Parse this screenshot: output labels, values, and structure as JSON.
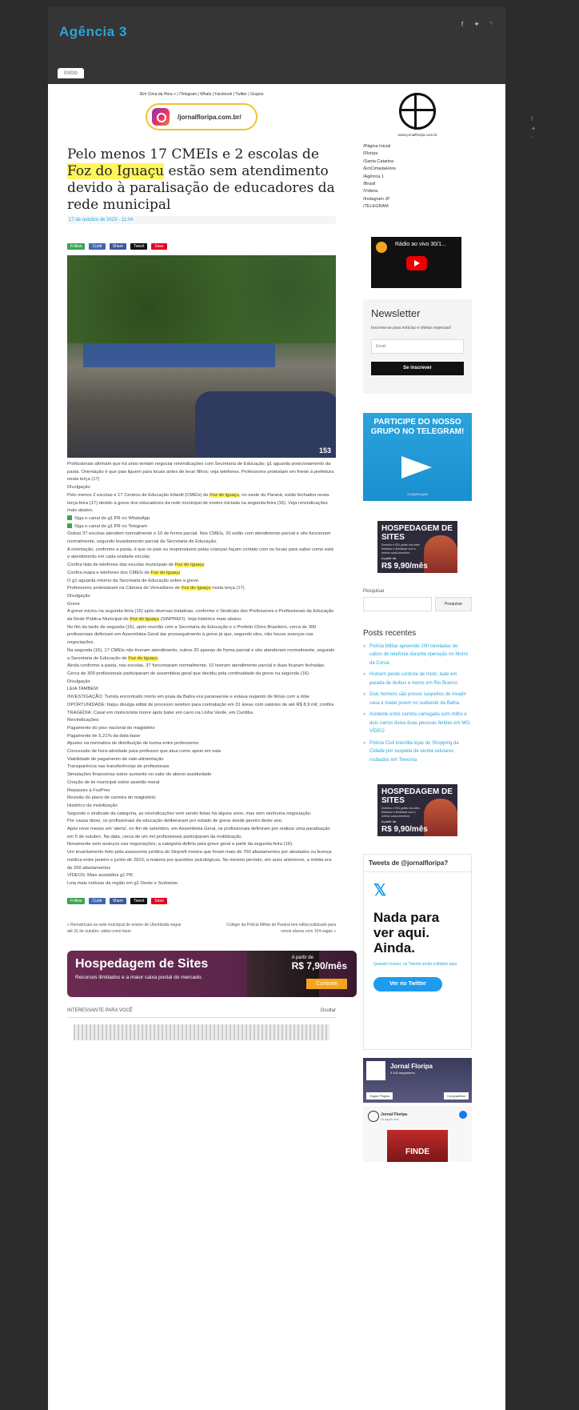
{
  "site": {
    "logo": "Agência 3",
    "tab": "Início"
  },
  "top_social": [
    "f",
    "t",
    "rss"
  ],
  "side_social": [
    "f",
    "t",
    "rss"
  ],
  "article": {
    "toplinks": "/Em Cima da Hora > | /Telegram | Whats | Facebook | Twitter | Grupos",
    "instagram": "/jornalfloripa.com.br/",
    "title_pre": "Pelo menos 17 CMEIs e 2 escolas de ",
    "title_hl": "Foz do Iguaçu",
    "title_post": " estão sem atendimento devido à paralisação de educadores da rede municipal",
    "date": "17 de outubro de 2023 - 11:04",
    "share": [
      "Follow",
      "Curtir",
      "Share",
      "Tweet",
      "Save"
    ],
    "photo_caption_number": "153",
    "paragraphs": [
      "Profissionais afirmam que há anos tentam negociar reivindicações com Secretaria de Educação; g1 aguarda posicionamento da pasta. Orientação é que pais liguem para locais antes de levar filhos; veja telefones. Professores protestam em frente à prefeitura nesta terça (17)",
      "Divulgação",
      "Pelo menos 2 escolas e 17 Centros de Educação Infantil (CMEIs) de Foz do Iguaçu, no oeste do Paraná, estão fechados nesta terça-feira (17) devido à greve dos educadores da rede municipal de ensino iniciada na segunda-feira (16). Veja reivindicações mais abaixo.",
      "Siga o canal do g1 PR no WhatsApp",
      "Siga o canal do g1 PR no Telegram",
      "Outras 37 escolas atendem normalmente e 10 de forma parcial. Nos CMEIs, 20 estão com atendimento parcial e oito funcionam normalmente, segundo levantamento parcial da Secretaria de Educação.",
      "A orientação, conforme a pasta, é que os pais ou responsáveis pelas crianças façam contato com os locais para saber como está o atendimento em cada unidade escolar.",
      "Confira lista de telefones das escolas municipais de Foz do Iguaçu",
      "Confira mapa e telefones dos CMEIs de Foz do Iguaçu",
      "O g1 aguarda retorno da Secretaria de Educação sobre a greve.",
      "Professores protestaram na Câmara de Vereadores de Foz do Iguaçu nesta terça (17)",
      "Divulgação",
      "Greve",
      "A greve iniciou na segunda-feira (16) após diversas tratativas, conforme o Sindicato dos Professores e Profissionais da Educação da Rede Pública Municipal de Foz do Iguaçu (SINPREFI). Veja histórico mais abaixo.",
      "No fim da tarde de segunda (16), após reunião com a Secretaria de Educação e o Prefeito Chico Brasileiro, cerca de 300 profissionais definiram em Assembleia Geral dar prosseguimento à greve já que, segundo eles, não houve avanços nas negociações.",
      "Na segunda (16), 17 CMEIs não tiveram atendimento, outros 20 apenas de forma parcial e oito atenderam normalmente, segundo a Secretaria de Educação de Foz do Iguaçu.",
      "Ainda conforme a pasta, nas escolas, 37 funcionaram normalmente, 10 tiveram atendimento parcial e duas ficaram fechadas.",
      "Cerca de 300 profissionais participaram de assembleia geral que decidiu pela continuidade da greve na segunda (16)",
      "Divulgação",
      "LEIA TAMBÉM:",
      "INVESTIGAÇÃO: Turista encontrado morto em praia da Bahia era paranaense e estava viajando de férias com a mãe",
      "OPORTUNIDADE: Itaipu divulga edital de processo seletivo para contratação em 31 áreas com salários de até R$ 8,9 mil; confira",
      "TRAGÉDIA: Casal em motocicleta morre após bater em carro na Linha Verde, em Curitiba",
      "Reivindicações:",
      "Pagamento do piso nacional do magistério",
      "Pagamento de 5,21% da data-base",
      "Ajustes na normativa de distribuição de turma entre professores",
      "Concessão de hora-atividade para professor que atua como apoio em sala",
      "Viabilidade de pagamento de vale-alimentação",
      "Transparência nas transferências de profissionais",
      "Simulações financeiras sobre aumento no valor do abono assiduidade",
      "Criação de lei municipal sobre assédio moral",
      "Repasses à FozPrev",
      "Revisão do plano de carreira do magistério",
      "Histórico da mobilização",
      "Segundo o sindicato da categoria, as reivindicações vem sendo feitas há alguns anos, mas sem nenhuma negociação.",
      "Por causa disso, os profissionais da educação deliberaram por estado de greve desde janeiro deste ano.",
      "Após nove meses em 'alerta', no fim de setembro, em Assembleia Geral, os profissionais definiram por realizar uma paralisação em 5 de outubro. Na data, cerca de um mil profissionais participaram da mobilização.",
      "Novamente sem avanços nas negociações, a categoria definiu pela greve geral a partir da segunda-feira (16).",
      "Um levantamento feito pela assessoria jurídica do Sinprefi mostra que foram mais de 700 afastamentos por atestados ou licença médica entre janeiro e junho de 2023, a maioria por questões psicológicas. No mesmo período, em anos anteriores, a média era de 250 afastamentos",
      "VÍDEOS: Mais assistidos g1 PR",
      "Leia mais notícias da região em g1 Oeste e Sudoeste."
    ],
    "prev_post": "« Rematrícula na rede municipal de ensino de Uberlândia segue até 31 de outubro; saiba como fazer",
    "next_post": "Colégio da Polícia Militar do Paraná tem edital publicado para novos alunos com 154 vagas »"
  },
  "ad_big": {
    "title": "Hospedagem de Sites",
    "subtitle": "Recursos ilimitados e a maior caixa postal do mercado.",
    "price_label": "A partir de",
    "price": "R$ 7,90/mês",
    "cta": "Contrate"
  },
  "interest": {
    "label": "INTERESSANTE PARA VOCÊ",
    "close": "Ocultar"
  },
  "sidebar": {
    "jf_url": "www.jornalfloripa.com.br",
    "nav": [
      "/Página Inicial",
      "/Floripa",
      "/Santa Catarina",
      "/EmCimadaHora",
      "/Agência 1",
      "/Brasil",
      "/Vídeos",
      "/Instagram JF",
      "/TELEGRAM"
    ],
    "video_title": "Rádio ao vivo 30/1...",
    "newsletter": {
      "title": "Newsletter",
      "desc": "Inscreva-se para notícias e ofertas especiais!",
      "placeholder": "Email",
      "button": "Se inscrever"
    },
    "telegram": {
      "title": "PARTICIPE DO NOSSO GRUPO NO TELEGRAM!",
      "small": "CLIQUE AQUI"
    },
    "hosp": {
      "title": "HOSPEDAGEM DE SITES",
      "desc": "Domínio e SSL grátis nos sites limitados e ilimitados com o melhor custo-benefício",
      "from": "A partir de:",
      "price": "R$ 9,90/mês"
    },
    "search": {
      "label": "Pesquisar",
      "button": "Pesquisar"
    },
    "recent_title": "Posts recentes",
    "recent": [
      "Polícia Militar apreende 200 toneladas de cabos de telefonia durante operação no Morro da Coroa",
      "Homem perde controle de moto, bate em parada de ônibus e morre em Rio Branco",
      "Dois homens são presos suspeitos de invadir casa e matar jovem no sudoeste da Bahia",
      "Acidente entre carreta carregada com milho e dois carros deixa duas pessoas feridas em MG; VÍDEO",
      "Polícia Civil interdita lojas do Shopping da Cidade por suspeita de venda celulares roubados em Teresina"
    ],
    "tweets": {
      "title": "Tweets de @jornalfloripa?",
      "empty": "Nada para ver aqui. Ainda.",
      "small": "Quando houver, os Tweets serão exibidos aqui.",
      "button": "Ver no Twitter"
    },
    "fb": {
      "name": "Jornal Floripa",
      "followers": "3.152 seguidores",
      "follow": "Seguir Página",
      "share": "Compartilhar",
      "post_name": "Jornal Floripa",
      "post_date": "há alguns dias",
      "post_img": "FINDE"
    }
  },
  "colors": {
    "accent": "#29a6d8",
    "highlight": "#fff55a",
    "dark": "#353535"
  }
}
